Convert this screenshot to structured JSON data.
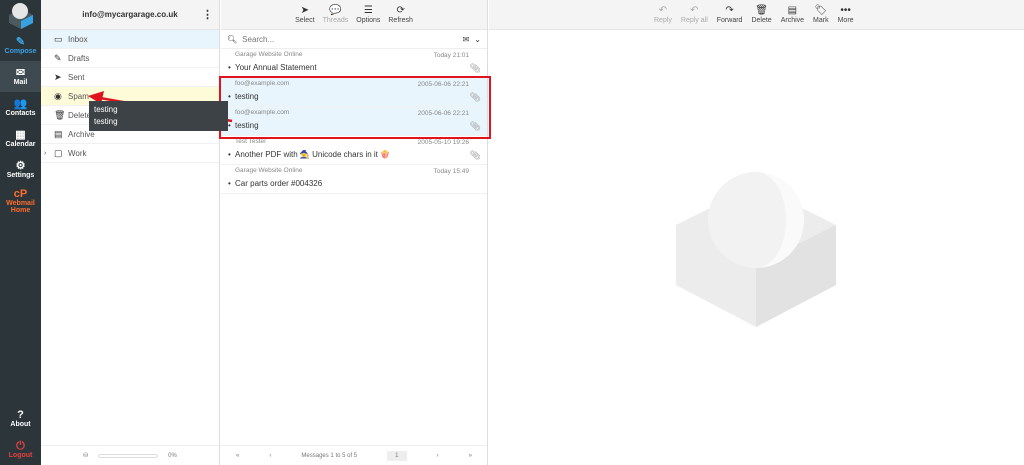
{
  "nav": [
    {
      "label": "Compose",
      "icon": "compose-icon",
      "glyph": "✎",
      "color": "#37a1e2"
    },
    {
      "label": "Mail",
      "icon": "mail-icon",
      "glyph": "✉",
      "active": true
    },
    {
      "label": "Contacts",
      "icon": "contacts-icon",
      "glyph": "👥"
    },
    {
      "label": "Calendar",
      "icon": "calendar-icon",
      "glyph": "▦"
    },
    {
      "label": "Settings",
      "icon": "gear-icon",
      "glyph": "⚙"
    },
    {
      "label": "Webmail Home",
      "icon": "cpanel-icon",
      "glyph": "cP",
      "color": "#ff6c2c"
    }
  ],
  "nav_bottom": [
    {
      "label": "About",
      "icon": "question-icon",
      "glyph": "?"
    },
    {
      "label": "Logout",
      "icon": "power-icon",
      "glyph": "⏻",
      "color": "#e5403f"
    }
  ],
  "account": "info@mycargarage.co.uk",
  "folders": [
    {
      "label": "Inbox",
      "icon": "inbox-icon",
      "glyph": "▭"
    },
    {
      "label": "Drafts",
      "icon": "pencil-icon",
      "glyph": "✎"
    },
    {
      "label": "Sent",
      "icon": "paper-plane-icon",
      "glyph": "➤"
    },
    {
      "label": "Spam",
      "icon": "spam-icon",
      "glyph": "◉"
    },
    {
      "label": "Deleted",
      "icon": "trash-icon",
      "glyph": "🗑"
    },
    {
      "label": "Archive",
      "icon": "archive-icon",
      "glyph": "▤"
    },
    {
      "label": "Work",
      "icon": "folder-icon",
      "glyph": "▢"
    }
  ],
  "quota": "0%",
  "list_toolbar": [
    {
      "label": "Select",
      "glyph": "➤"
    },
    {
      "label": "Threads",
      "glyph": "💬",
      "disabled": true
    },
    {
      "label": "Options",
      "glyph": "☰"
    },
    {
      "label": "Refresh",
      "glyph": "⟳"
    }
  ],
  "search_placeholder": "Search...",
  "messages": [
    {
      "from": "Garage Website Online",
      "date": "Today 21:01",
      "subject": "Your Annual Statement",
      "attach": true
    },
    {
      "from": "foo@example.com",
      "date": "2005-06-06 22:21",
      "subject": "testing",
      "attach": true,
      "selected": true
    },
    {
      "from": "foo@example.com",
      "date": "2005-06-06 22:21",
      "subject": "testing",
      "attach": true,
      "selected": true
    },
    {
      "from": "Test Tester",
      "date": "2005-05-10 19:26",
      "subject": "Another PDF with 🧙 Unicode chars in it 🍿",
      "attach": true
    },
    {
      "from": "Garage Website Online",
      "date": "Today 15:49",
      "subject": "Car parts order #004326",
      "attach": false
    }
  ],
  "pager": {
    "first": "«",
    "prev": "‹",
    "count": "Messages 1 to 5 of 5",
    "page": "1",
    "next": "›",
    "last": "»"
  },
  "preview_toolbar": [
    {
      "label": "Reply",
      "glyph": "↶",
      "disabled": true
    },
    {
      "label": "Reply all",
      "glyph": "↶",
      "disabled": true
    },
    {
      "label": "Forward",
      "glyph": "↷"
    },
    {
      "label": "Delete",
      "glyph": "🗑"
    },
    {
      "label": "Archive",
      "glyph": "▤"
    },
    {
      "label": "Mark",
      "glyph": "🏷"
    },
    {
      "label": "More",
      "glyph": "•••"
    }
  ],
  "tooltip": [
    "testing",
    "testing"
  ],
  "colors": {
    "annotation": "#e0141e",
    "selected": "#e8f5fc",
    "sidebar": "#2c363a"
  }
}
